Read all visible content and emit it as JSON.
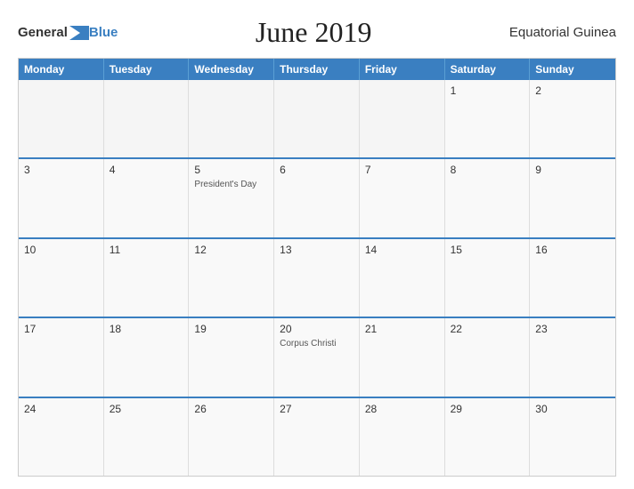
{
  "header": {
    "logo_general": "General",
    "logo_blue": "Blue",
    "title": "June 2019",
    "country": "Equatorial Guinea"
  },
  "calendar": {
    "days_of_week": [
      "Monday",
      "Tuesday",
      "Wednesday",
      "Thursday",
      "Friday",
      "Saturday",
      "Sunday"
    ],
    "weeks": [
      [
        {
          "day": "",
          "event": ""
        },
        {
          "day": "",
          "event": ""
        },
        {
          "day": "",
          "event": ""
        },
        {
          "day": "",
          "event": ""
        },
        {
          "day": "",
          "event": ""
        },
        {
          "day": "1",
          "event": ""
        },
        {
          "day": "2",
          "event": ""
        }
      ],
      [
        {
          "day": "3",
          "event": ""
        },
        {
          "day": "4",
          "event": ""
        },
        {
          "day": "5",
          "event": "President's Day"
        },
        {
          "day": "6",
          "event": ""
        },
        {
          "day": "7",
          "event": ""
        },
        {
          "day": "8",
          "event": ""
        },
        {
          "day": "9",
          "event": ""
        }
      ],
      [
        {
          "day": "10",
          "event": ""
        },
        {
          "day": "11",
          "event": ""
        },
        {
          "day": "12",
          "event": ""
        },
        {
          "day": "13",
          "event": ""
        },
        {
          "day": "14",
          "event": ""
        },
        {
          "day": "15",
          "event": ""
        },
        {
          "day": "16",
          "event": ""
        }
      ],
      [
        {
          "day": "17",
          "event": ""
        },
        {
          "day": "18",
          "event": ""
        },
        {
          "day": "19",
          "event": ""
        },
        {
          "day": "20",
          "event": "Corpus Christi"
        },
        {
          "day": "21",
          "event": ""
        },
        {
          "day": "22",
          "event": ""
        },
        {
          "day": "23",
          "event": ""
        }
      ],
      [
        {
          "day": "24",
          "event": ""
        },
        {
          "day": "25",
          "event": ""
        },
        {
          "day": "26",
          "event": ""
        },
        {
          "day": "27",
          "event": ""
        },
        {
          "day": "28",
          "event": ""
        },
        {
          "day": "29",
          "event": ""
        },
        {
          "day": "30",
          "event": ""
        }
      ]
    ]
  }
}
